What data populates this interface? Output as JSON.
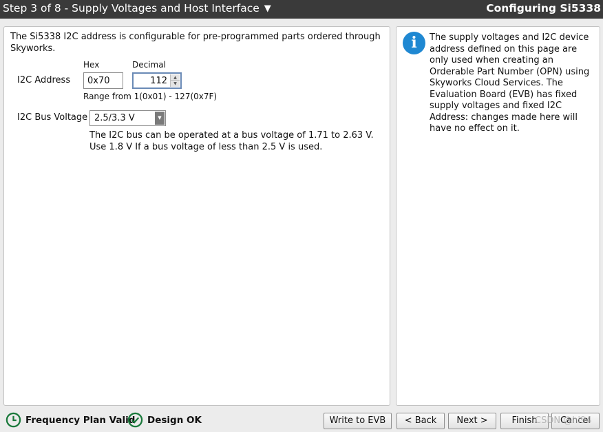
{
  "header": {
    "step_title": "Step 3 of 8 - Supply Voltages and Host Interface",
    "step_arrow": "▼",
    "config_title": "Configuring Si5338"
  },
  "main": {
    "intro": "The Si5338 I2C address is configurable for pre-programmed parts ordered through Skyworks.",
    "hex_heading": "Hex",
    "decimal_heading": "Decimal",
    "address_label": "I2C Address",
    "hex_value": "0x70",
    "decimal_value": "112",
    "range_text": "Range from 1(0x01) - 127(0x7F)",
    "bus_label": "I2C Bus Voltage",
    "bus_value": "2.5/3.3 V",
    "bus_note": "The I2C bus can be operated at a bus voltage of 1.71 to 2.63 V. Use 1.8 V If a bus voltage of less than 2.5 V is used."
  },
  "info": {
    "icon": "info-icon",
    "text": "The supply voltages and I2C device address defined on this page are only used when creating an Orderable Part Number (OPN) using Skyworks Cloud Services. The Evaluation Board (EVB) has fixed supply voltages and fixed I2C Address: changes made here will have no effect on it."
  },
  "status": {
    "frequency": "Frequency Plan Valid",
    "design": "Design OK",
    "ok_color": "#1b7a3c"
  },
  "buttons": {
    "write_evb": "Write to EVB",
    "back": "< Back",
    "next": "Next >",
    "finish": "Finish",
    "cancel": "Cancel"
  },
  "watermark": "CSDN @hi94"
}
